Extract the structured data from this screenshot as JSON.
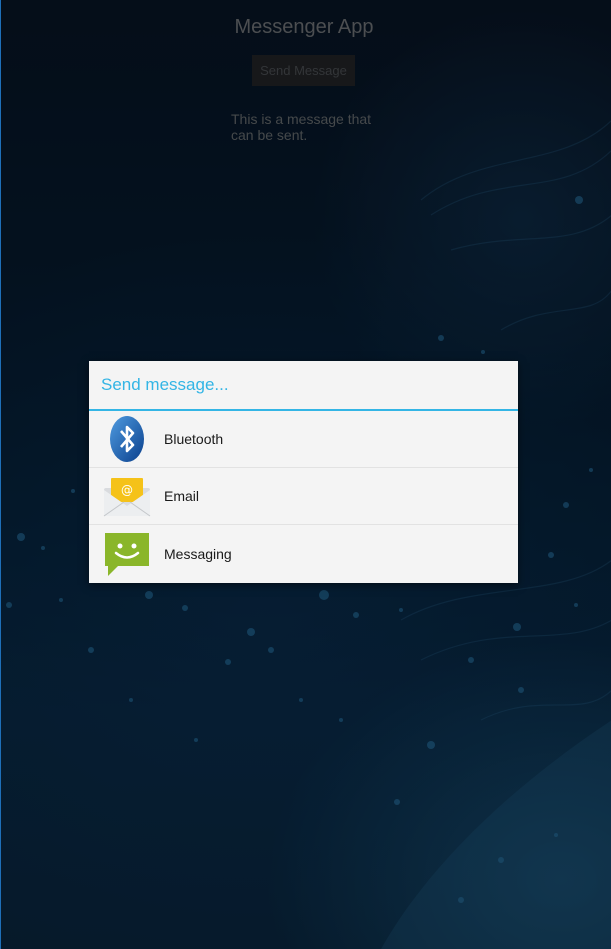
{
  "app": {
    "title": "Messenger App",
    "send_button_label": "Send Message",
    "message_text": "This is a message that can be sent."
  },
  "dialog": {
    "title": "Send message...",
    "options": [
      {
        "label": "Bluetooth",
        "icon": "bluetooth-icon"
      },
      {
        "label": "Email",
        "icon": "email-icon"
      },
      {
        "label": "Messaging",
        "icon": "messaging-icon"
      }
    ]
  },
  "colors": {
    "accent": "#33b5e5",
    "dialog_background": "#f4f4f4",
    "messaging_green": "#8ab62a"
  }
}
